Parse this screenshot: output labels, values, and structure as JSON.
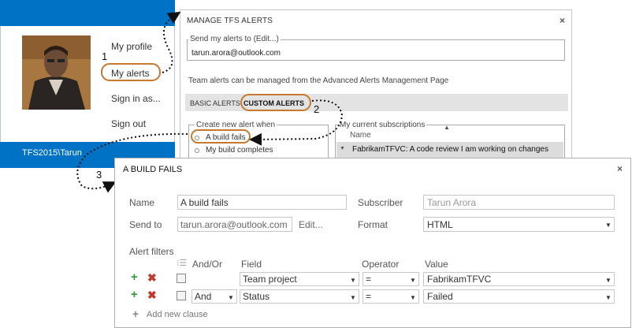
{
  "profile": {
    "user_name": "Tarun Arora",
    "menu": [
      "My profile",
      "My alerts",
      "Sign in as...",
      "Sign out"
    ],
    "footer": "TFS2015\\Tarun"
  },
  "steps": [
    "1",
    "2",
    "3"
  ],
  "manage_dialog": {
    "title": "MANAGE TFS ALERTS",
    "close": "×",
    "send_to_legend": "Send my alerts to (Edit...)",
    "send_to_value": "tarun.arora@outlook.com",
    "team_note": "Team alerts can be managed from the Advanced Alerts Management Page",
    "tabs": [
      "BASIC ALERTS",
      "CUSTOM ALERTS"
    ],
    "create_legend": "Create new alert when",
    "create_options": [
      "A build fails",
      "My build completes"
    ],
    "subs_legend": "My current subscriptions",
    "subs_column": "Name",
    "subs_row": "FabrikamTFVC: A code review I am working on changes"
  },
  "build_dialog": {
    "title": "A BUILD FAILS",
    "close": "×",
    "name_label": "Name",
    "name_value": "A build fails",
    "subscriber_label": "Subscriber",
    "subscriber_value": "Tarun Arora",
    "sendto_label": "Send to",
    "sendto_value": "tarun.arora@outlook.com",
    "edit_link": "Edit...",
    "format_label": "Format",
    "format_value": "HTML",
    "filters_label": "Alert filters",
    "columns": {
      "andor": "And/Or",
      "field": "Field",
      "operator": "Operator",
      "value": "Value"
    },
    "rows": [
      {
        "andor": "",
        "field": "Team project",
        "operator": "=",
        "value": "FabrikamTFVC"
      },
      {
        "andor": "And",
        "field": "Status",
        "operator": "=",
        "value": "Failed"
      }
    ],
    "add_clause": "Add new clause"
  },
  "colors": {
    "brand_blue": "#0072c6",
    "highlight": "#c87930",
    "add_green": "#2f9a3a",
    "delete_red": "#c0392b"
  }
}
